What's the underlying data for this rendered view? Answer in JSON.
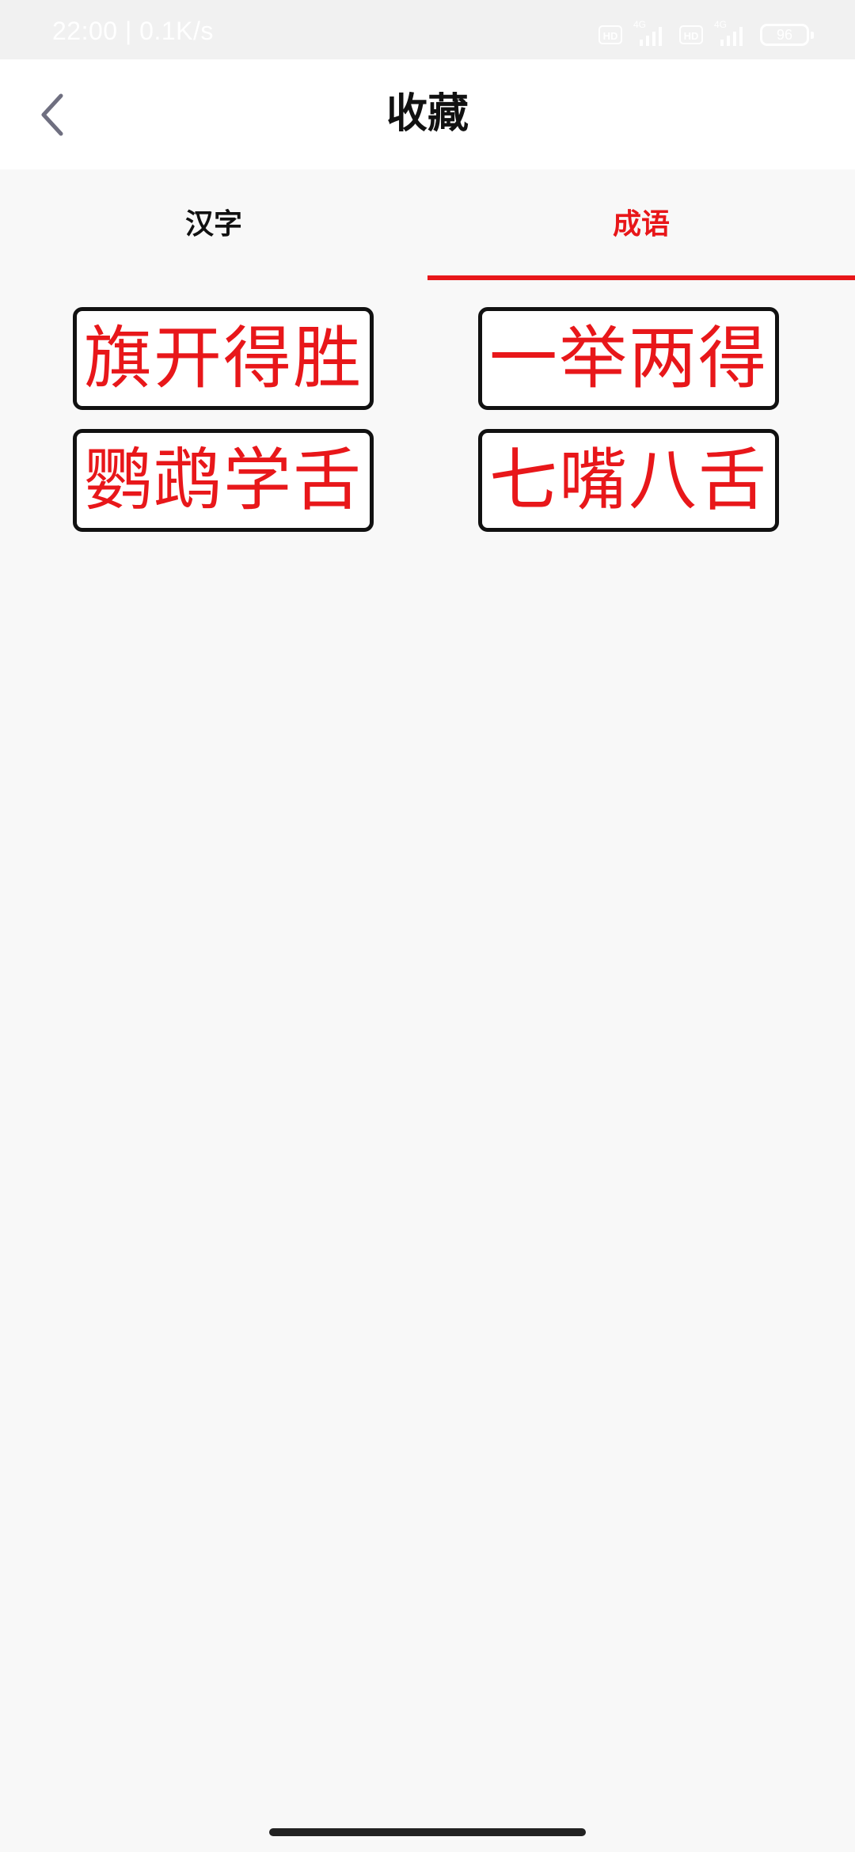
{
  "status_bar": {
    "time_speed": "22:00 | 0.1K/s",
    "hd_badge_1": "HD",
    "network_1": "4G",
    "hd_badge_2": "HD",
    "network_2": "4G",
    "battery": "96"
  },
  "header": {
    "title": "收藏",
    "back_icon": "chevron-left-icon"
  },
  "tabs": [
    {
      "label": "汉字",
      "active": false
    },
    {
      "label": "成语",
      "active": true
    }
  ],
  "favorites": [
    {
      "text": "旗开得胜"
    },
    {
      "text": "一举两得"
    },
    {
      "text": "鹦鹉学舌"
    },
    {
      "text": "七嘴八舌"
    }
  ],
  "colors": {
    "accent": "#e8171a",
    "card_border": "#111111",
    "background": "#f8f8f8"
  }
}
